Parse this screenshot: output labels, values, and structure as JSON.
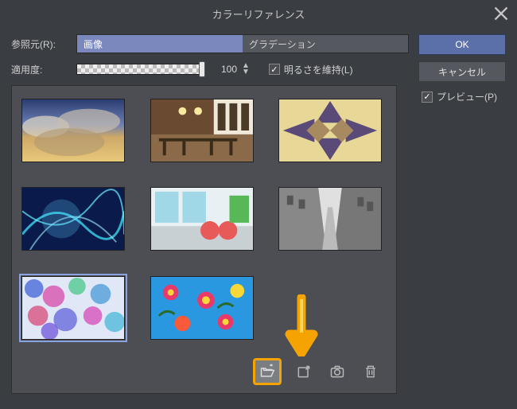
{
  "title": "カラーリファレンス",
  "labels": {
    "source": "参照元(R):",
    "apply_amount": "適用度:"
  },
  "source_tabs": {
    "image": "画像",
    "gradation": "グラデーション"
  },
  "apply_value": "100",
  "keep_brightness_label": "明るさを維持(L)",
  "buttons": {
    "ok": "OK",
    "cancel": "キャンセル"
  },
  "preview_label": "プレビュー(P)",
  "icons": {
    "open": "open-folder-icon",
    "export": "export-icon",
    "camera": "camera-icon",
    "delete": "trash-icon"
  }
}
